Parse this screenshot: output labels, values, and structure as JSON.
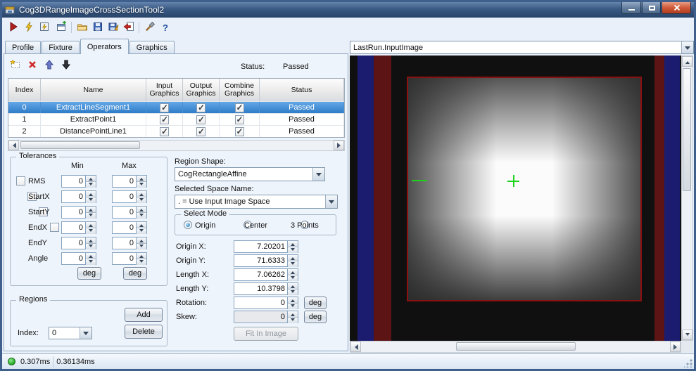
{
  "window": {
    "title": "Cog3DRangeImageCrossSectionTool2"
  },
  "toolbar": {
    "icons": [
      "run",
      "run-once",
      "live-run",
      "new-tool",
      "open",
      "save",
      "save-as",
      "import",
      "tools",
      "help"
    ]
  },
  "tabs": {
    "items": [
      {
        "label": "Profile"
      },
      {
        "label": "Fixture"
      },
      {
        "label": "Operators"
      },
      {
        "label": "Graphics"
      }
    ],
    "active": "Operators"
  },
  "operators": {
    "status_label": "Status:",
    "status_value": "Passed",
    "columns": [
      "Index",
      "Name",
      "Input Graphics",
      "Output Graphics",
      "Combine Graphics",
      "Status"
    ],
    "rows": [
      {
        "index": "0",
        "name": "ExtractLineSegment1",
        "input_graphics": true,
        "output_graphics": true,
        "combine_graphics": true,
        "status": "Passed",
        "selected": true
      },
      {
        "index": "1",
        "name": "ExtractPoint1",
        "input_graphics": true,
        "output_graphics": true,
        "combine_graphics": true,
        "status": "Passed",
        "selected": false
      },
      {
        "index": "2",
        "name": "DistancePointLine1",
        "input_graphics": true,
        "output_graphics": true,
        "combine_graphics": true,
        "status": "Passed",
        "selected": false
      }
    ]
  },
  "tolerances": {
    "title": "Tolerances",
    "min_header": "Min",
    "max_header": "Max",
    "deg_label": "deg",
    "rows": [
      {
        "label": "RMS",
        "min": "0",
        "max": "0"
      },
      {
        "label": "StartX",
        "min": "0",
        "max": "0"
      },
      {
        "label": "StartY",
        "min": "0",
        "max": "0"
      },
      {
        "label": "EndX",
        "min": "0",
        "max": "0"
      },
      {
        "label": "EndY",
        "min": "0",
        "max": "0"
      },
      {
        "label": "Angle",
        "min": "0",
        "max": "0"
      }
    ]
  },
  "region": {
    "shape_label": "Region Shape:",
    "shape_value": "CogRectangleAffine",
    "space_label": "Selected Space Name:",
    "space_value": ". = Use Input Image Space",
    "mode_title": "Select Mode",
    "modes": [
      {
        "label": "Origin",
        "selected": true
      },
      {
        "label": "Center",
        "selected": false
      },
      {
        "label": "3 Points",
        "selected": false
      }
    ],
    "fields": [
      {
        "label": "Origin X:",
        "value": "7.20201"
      },
      {
        "label": "Origin Y:",
        "value": "71.6333"
      },
      {
        "label": "Length X:",
        "value": "7.06262"
      },
      {
        "label": "Length Y:",
        "value": "10.3798"
      },
      {
        "label": "Rotation:",
        "value": "0"
      },
      {
        "label": "Skew:",
        "value": "0"
      }
    ],
    "deg_label": "deg",
    "fit_button": "Fit In Image"
  },
  "regions_box": {
    "title": "Regions",
    "add_button": "Add",
    "index_label": "Index:",
    "index_value": "0",
    "delete_button": "Delete"
  },
  "display": {
    "source": "LastRun.InputImage"
  },
  "status_bar": {
    "time1": "0.307ms",
    "time2": "0.36134ms"
  },
  "colors": {
    "selected_row": "#2e7cc8",
    "status_dot": "#35b435",
    "overlay_red": "#8a1111",
    "marker_green": "#1bd41b",
    "stripe_blue": "#1b1b70",
    "stripe_red": "#5c1414"
  }
}
